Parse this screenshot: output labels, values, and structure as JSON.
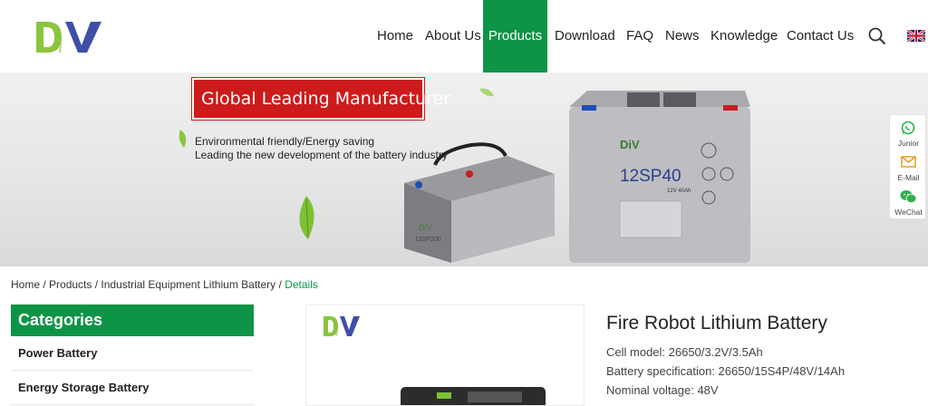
{
  "header": {
    "logo_text": "DiV",
    "nav": [
      {
        "label": "Home"
      },
      {
        "label": "About Us"
      },
      {
        "label": "Products"
      },
      {
        "label": "Download"
      },
      {
        "label": "FAQ"
      },
      {
        "label": "News"
      },
      {
        "label": "Knowledge"
      },
      {
        "label": "Contact Us"
      }
    ],
    "active_nav": "Products",
    "search_icon": "search-icon",
    "language_icon": "uk-flag-icon",
    "brand_color": "#0d9446"
  },
  "banner": {
    "title": "Global Leading Manufacturer",
    "line1": "Environmental friendly/Energy saving",
    "line2": "Leading the new development of the battery industry",
    "battery_front": {
      "brand": "DiV",
      "model": "12SP40",
      "sub": "12V 40Ah"
    },
    "battery_back": {
      "brand": "DiV",
      "model": "12SP200"
    },
    "title_box_color": "#cc1b1b"
  },
  "side_panel": {
    "items": [
      {
        "label": "Junior",
        "icon": "whatsapp-icon"
      },
      {
        "label": "E-Mail",
        "icon": "email-icon"
      },
      {
        "label": "WeChat",
        "icon": "wechat-icon"
      }
    ]
  },
  "breadcrumb": {
    "home": "Home",
    "sep": " / ",
    "products": "Products",
    "category": "Industrial Equipment Lithium Battery",
    "current": "Details"
  },
  "categories": {
    "title": "Categories",
    "items": [
      {
        "label": "Power Battery"
      },
      {
        "label": "Energy Storage Battery"
      }
    ]
  },
  "product": {
    "image_logo": "DiV",
    "title": "Fire Robot Lithium Battery",
    "specs": [
      "Cell model: 26650/3.2V/3.5Ah",
      "Battery specification: 26650/15S4P/48V/14Ah",
      "Nominal voltage: 48V"
    ]
  }
}
